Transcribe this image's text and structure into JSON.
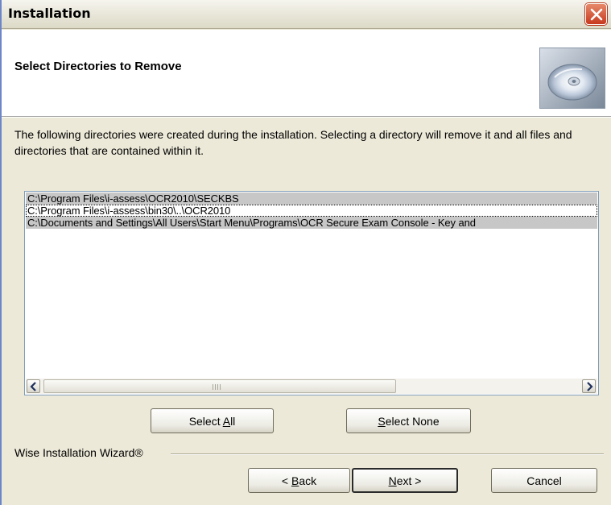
{
  "window": {
    "title": "Installation"
  },
  "header": {
    "title": "Select Directories to Remove",
    "icon": "cd-disc-icon"
  },
  "description": "The following directories were created during the installation.  Selecting a directory will remove it and all files and directories that are contained within it.",
  "directories": [
    {
      "path": "C:\\Program Files\\i-assess\\OCR2010\\SECKBS",
      "selected": true
    },
    {
      "path": "C:\\Program Files\\i-assess\\bin30\\..\\OCR2010",
      "selected": false
    },
    {
      "path": "C:\\Documents and Settings\\All Users\\Start Menu\\Programs\\OCR Secure Exam Console - Key and",
      "selected": true
    }
  ],
  "buttons": {
    "select_all": {
      "pre": "Select ",
      "key": "A",
      "post": "ll"
    },
    "select_none": {
      "pre": "",
      "key": "S",
      "post": "elect None"
    },
    "back": {
      "pre": "< ",
      "key": "B",
      "post": "ack"
    },
    "next": {
      "pre": "",
      "key": "N",
      "post": "ext >"
    },
    "cancel": "Cancel"
  },
  "footer": {
    "brand": "Wise Installation Wizard®"
  },
  "colors": {
    "dialog_bg": "#ece9d8",
    "selection_bg": "#c7c7c7",
    "close_button": "#c7391e"
  }
}
